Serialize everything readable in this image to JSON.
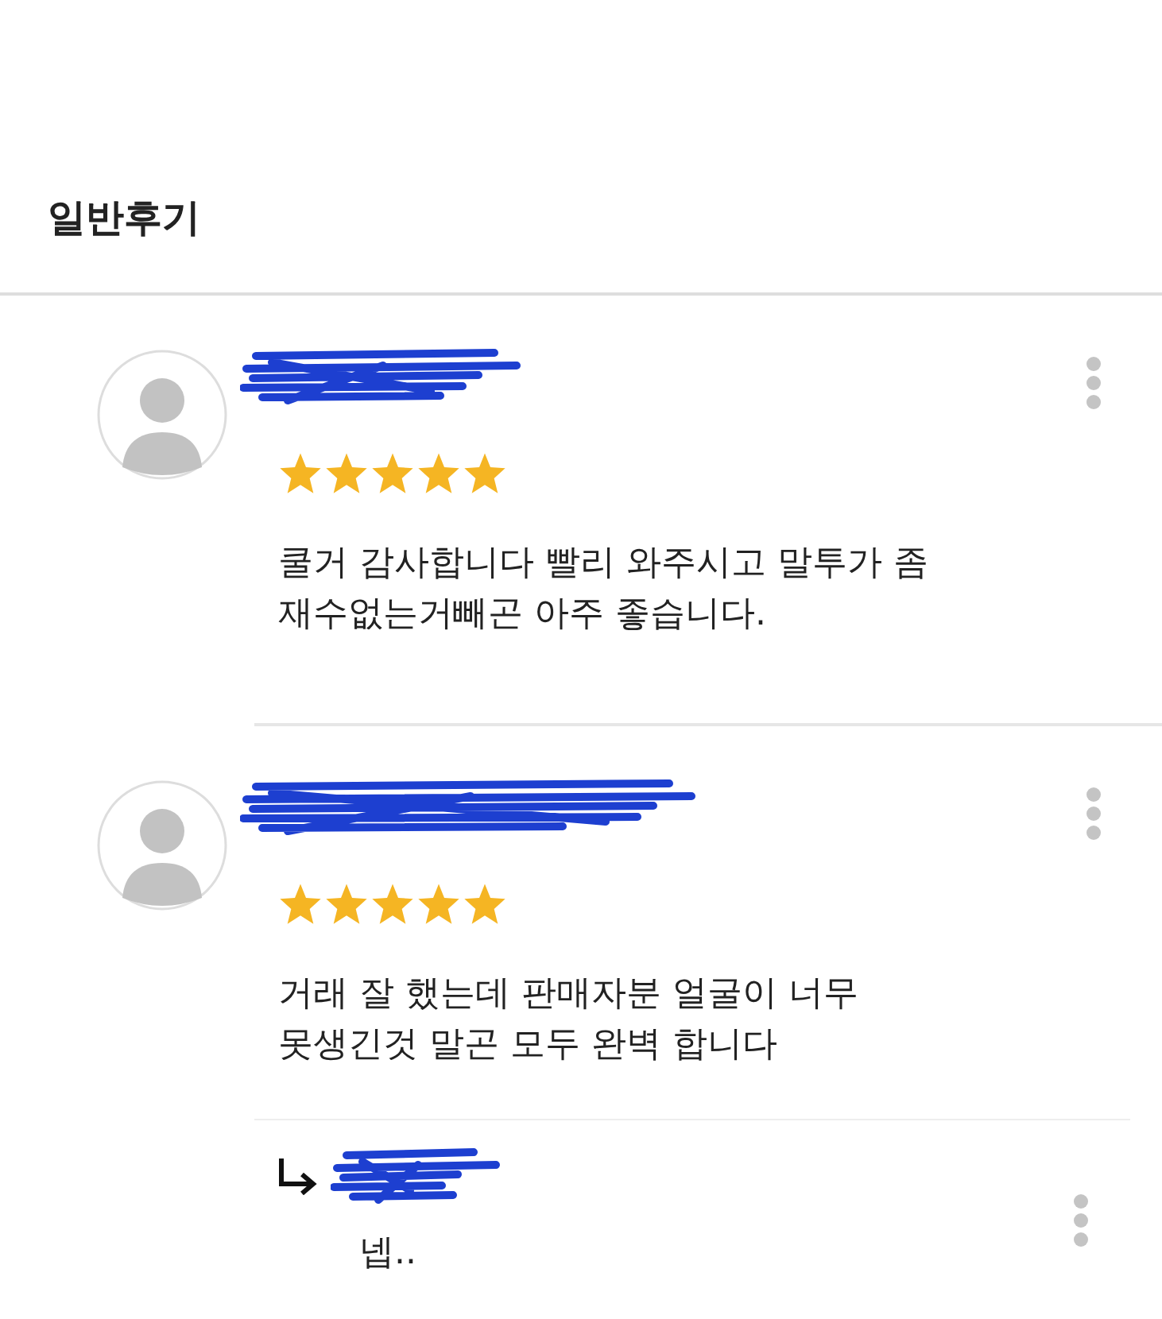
{
  "title": "일반후기",
  "reviews": [
    {
      "stars": 5,
      "text": "쿨거 감사합니다 빨리 와주시고 말투가 좀\n재수없는거빼곤 아주 좋습니다."
    },
    {
      "stars": 5,
      "text": "거래 잘 했는데 판매자분 얼굴이 너무\n못생긴것 말곤 모두 완벽 합니다",
      "reply": {
        "text": "넵.."
      }
    }
  ]
}
